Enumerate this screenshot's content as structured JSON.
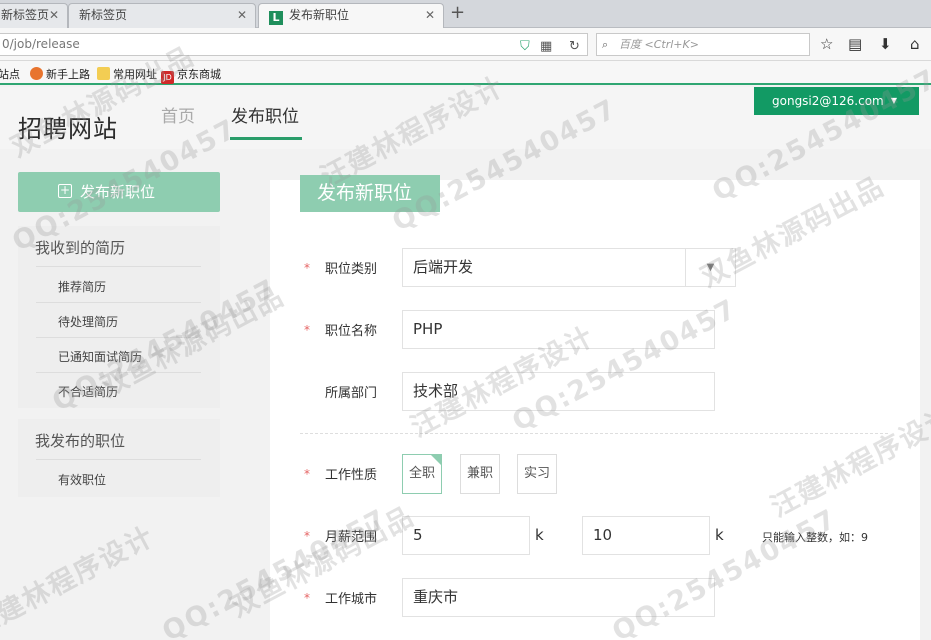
{
  "browser": {
    "tabs": [
      {
        "label": "新标签页"
      },
      {
        "label": "新标签页"
      },
      {
        "label": "发布新职位",
        "logo": "L"
      }
    ],
    "url": "0/job/release",
    "search_placeholder": "百度 <Ctrl+K>",
    "bookmarks": [
      {
        "label": "站点"
      },
      {
        "label": "新手上路"
      },
      {
        "label": "常用网址"
      },
      {
        "label": "京东商城",
        "badge": "JD"
      }
    ]
  },
  "header": {
    "logo": "招聘网站",
    "nav": [
      {
        "label": "首页"
      },
      {
        "label": "发布职位"
      }
    ],
    "user": "gongsi2@126.com",
    "accent": "#129a64"
  },
  "sidebar": {
    "new_button": "发布新职位",
    "group1": {
      "title": "我收到的简历",
      "items": [
        "推荐简历",
        "待处理简历",
        "已通知面试简历",
        "不合适简历"
      ]
    },
    "group2": {
      "title": "我发布的职位",
      "items": [
        "有效职位"
      ]
    }
  },
  "form": {
    "title": "发布新职位",
    "category": {
      "label": "职位类别",
      "value": "后端开发"
    },
    "name": {
      "label": "职位名称",
      "value": "PHP"
    },
    "dept": {
      "label": "所属部门",
      "value": "技术部"
    },
    "nature": {
      "label": "工作性质",
      "options": [
        "全职",
        "兼职",
        "实习"
      ],
      "selected": "全职"
    },
    "salary": {
      "label": "月薪范围",
      "min": "5",
      "max": "10",
      "unit": "k",
      "hint": "只能输入整数，如：9"
    },
    "city": {
      "label": "工作城市",
      "value": "重庆市"
    }
  },
  "watermarks": {
    "qq": "QQ:254540457",
    "a": "汪建林程序设计",
    "b": "双鱼林源码出品"
  }
}
